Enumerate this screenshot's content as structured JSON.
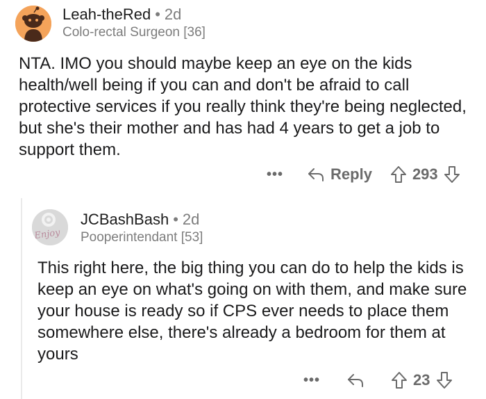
{
  "comments": [
    {
      "username": "Leah-theRed",
      "age": "2d",
      "flair": "Colo-rectal Surgeon [36]",
      "body": "NTA. IMO you should maybe keep an eye on the kids health/well being if you can and don't be afraid to call protective services if you really think they're being neglected, but she's their mother and has had 4 years to get a job to support them.",
      "more": "•••",
      "reply_label": "Reply",
      "score": "293"
    },
    {
      "username": "JCBashBash",
      "age": "2d",
      "flair": "Pooperintendant [53]",
      "avatar_text": "Enjoy",
      "body": "This right here, the big thing you can do to help the kids is keep an eye on what's going on with them, and make sure your house is ready so if CPS ever needs to place them somewhere else, there's already a bedroom for them at yours",
      "more": "•••",
      "score": "23"
    }
  ],
  "icons": {
    "separator": "•",
    "reply": "reply-arrow-icon",
    "upvote": "upvote-arrow-icon",
    "downvote": "downvote-arrow-icon"
  },
  "colors": {
    "avatar1_bg": "#f4a35a",
    "avatar2_bg": "#d8d8d8",
    "meta": "#7c7c7c"
  }
}
